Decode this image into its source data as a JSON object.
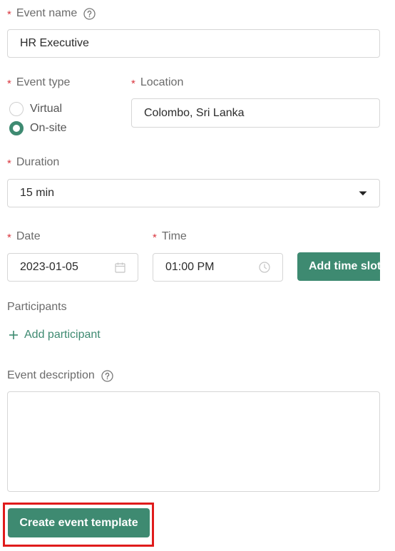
{
  "event_name": {
    "label": "Event name",
    "value": "HR Executive"
  },
  "event_type": {
    "label": "Event type",
    "options": [
      {
        "label": "Virtual",
        "checked": false
      },
      {
        "label": "On-site",
        "checked": true
      }
    ]
  },
  "location": {
    "label": "Location",
    "value": "Colombo, Sri Lanka"
  },
  "duration": {
    "label": "Duration",
    "value": "15 min"
  },
  "date": {
    "label": "Date",
    "value": "2023-01-05"
  },
  "time": {
    "label": "Time",
    "value": "01:00 PM"
  },
  "add_time_slot": {
    "label": "Add time slot"
  },
  "participants": {
    "label": "Participants",
    "add_label": "Add participant"
  },
  "event_description": {
    "label": "Event description",
    "value": ""
  },
  "create_button": {
    "label": "Create event template"
  },
  "colors": {
    "accent": "#3e8a71",
    "required": "#d9363e",
    "highlight": "#e01b1b"
  }
}
